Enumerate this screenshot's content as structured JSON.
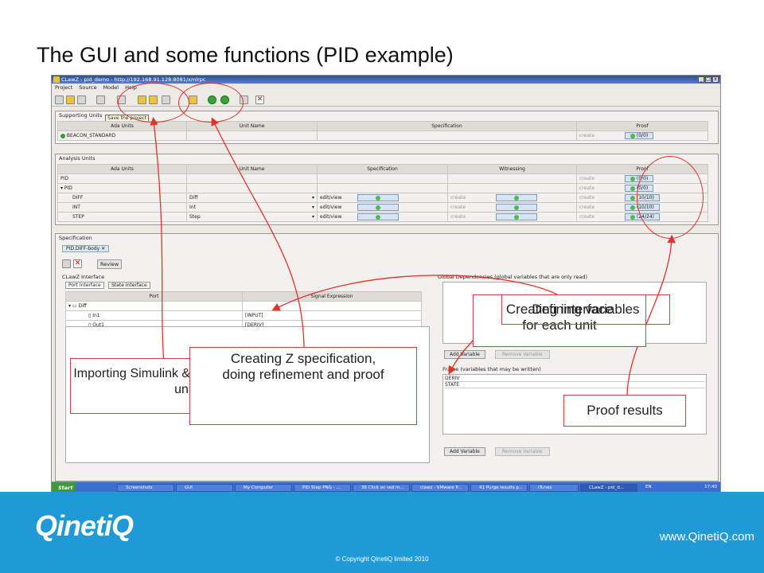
{
  "slide": {
    "title": "The GUI and some functions (PID example)"
  },
  "window": {
    "title": "CLawZ - pid_demo - http://192.168.91.128:8081/xmlrpc"
  },
  "menu": [
    "Project",
    "Source",
    "Model",
    "Help"
  ],
  "tooltip": "Save the project",
  "supporting": {
    "label": "Supporting Units",
    "headers": [
      "Ada Units",
      "Unit Name",
      "Specification",
      "Proof"
    ],
    "rows": [
      {
        "unit": "BEACON_STANDARD",
        "create": "create",
        "proof": "(0/0)"
      }
    ]
  },
  "analysis": {
    "label": "Analysis Units",
    "headers": [
      "Ada Units",
      "Unit Name",
      "Specification",
      "Witnessing",
      "Proof"
    ],
    "rows": [
      {
        "unit": "PID",
        "name": "",
        "spec": "",
        "create": "create",
        "proof": "(0/0)"
      },
      {
        "unit": "PID",
        "name": "",
        "spec": "",
        "create": "create",
        "proof": "(0/0)"
      },
      {
        "unit": "DIFF",
        "name": "Diff",
        "spec": "edit/view",
        "wcreate": "create",
        "create": "create",
        "proof": "(10/10)"
      },
      {
        "unit": "INT",
        "name": "Int",
        "spec": "edit/view",
        "wcreate": "create",
        "create": "create",
        "proof": "(10/10)"
      },
      {
        "unit": "STEP",
        "name": "Step",
        "spec": "edit/view",
        "wcreate": "create",
        "create": "create",
        "proof": "(24/24)"
      }
    ]
  },
  "spec": {
    "label": "Specification",
    "tab": "PID.DIFF-body",
    "review": "Review",
    "interface_label": "CLawZ Interface",
    "tabs": [
      "Port Interface",
      "State Interface"
    ],
    "headers": [
      "Port",
      "Signal Expression"
    ],
    "ports": [
      {
        "name": "Diff",
        "sig": ""
      },
      {
        "name": "In1",
        "sig": "[INPUT]"
      },
      {
        "name": "Out1",
        "sig": "[DERIV]"
      }
    ],
    "global_label": "Global Dependencies (global variables that are only read)",
    "frame_label": "Frame (variables that may be written)",
    "frame_items": [
      "DERIV",
      "STATE"
    ],
    "add_variable": "Add Variable",
    "remove_variable": "Remove Variable"
  },
  "annotations": {
    "importing": "Importing Simulink & Ada files & defining units",
    "creating_z": "Creating Z specification, doing refinement and proof",
    "creating_interface": "Creating interface for each unit",
    "defining_frames": "Defining variables",
    "proof_results": "Proof results"
  },
  "taskbar": {
    "start": "Start",
    "items": [
      "Screenshots",
      "GUI",
      "My Computer",
      "PID Step PNG - ...",
      "36 Click on red m...",
      "clawz - VMware P...",
      "41 Purge results p...",
      "iTunes",
      "CLawZ - pid_d..."
    ],
    "lang": "EN",
    "time": "17:40"
  },
  "footer": {
    "logo": "QinetiQ",
    "website": "www.QinetiQ.com",
    "copyright": "© Copyright QinetiQ limited 2010"
  },
  "colors": {
    "footer": "#1f9ad6",
    "annotation_border": "#d44040",
    "ok": "#4fb84f"
  }
}
